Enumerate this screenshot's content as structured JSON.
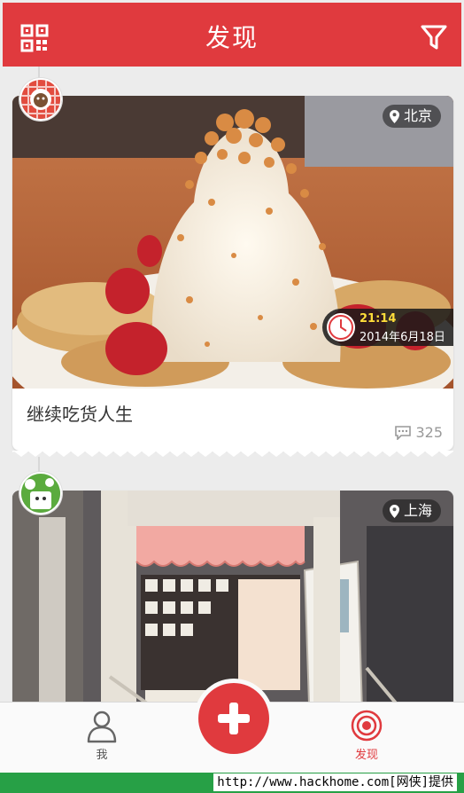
{
  "header": {
    "title": "发现",
    "left_icon": "qr-code-icon",
    "right_icon": "filter-funnel-icon",
    "bg_color": "#e03a3e"
  },
  "feed": [
    {
      "location": "北京",
      "time": "21:14",
      "date": "2014年6月18日",
      "caption": "继续吃货人生",
      "comment_count": "325",
      "photo_subject": "pancakes with whipped cream and strawberries"
    },
    {
      "location": "上海",
      "photo_subject": "storefront with pink awning"
    }
  ],
  "bottom_nav": {
    "me_label": "我",
    "discover_label": "发现",
    "add_icon": "plus-icon",
    "active_color": "#e03a3e"
  },
  "watermark": "http://www.hackhome.com[网侠]提供"
}
